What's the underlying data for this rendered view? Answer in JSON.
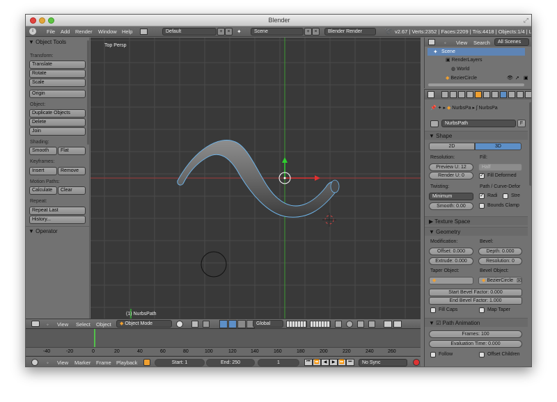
{
  "window": {
    "title": "Blender"
  },
  "topbar": {
    "menus": [
      "File",
      "Add",
      "Render",
      "Window",
      "Help"
    ],
    "layout": "Default",
    "scene": "Scene",
    "engine": "Blender Render",
    "stats": "v2.67 | Verts:2352 | Faces:2209 | Tris:4418 | Objects:1/4 | La"
  },
  "toolshelf": {
    "title": "Object Tools",
    "transform_label": "Transform:",
    "translate": "Translate",
    "rotate": "Rotate",
    "scale": "Scale",
    "origin": "Origin",
    "object_label": "Object:",
    "duplicate": "Duplicate Objects",
    "delete": "Delete",
    "join": "Join",
    "shading_label": "Shading:",
    "smooth": "Smooth",
    "flat": "Flat",
    "keyframes_label": "Keyframes:",
    "insert": "Insert",
    "remove": "Remove",
    "motion_label": "Motion Paths:",
    "calculate": "Calculate",
    "clear": "Clear",
    "repeat_label": "Repeat:",
    "repeat_last": "Repeat Last",
    "history": "History...",
    "operator": "Operator"
  },
  "viewport": {
    "view_name": "Top Persp",
    "object_label": "(1) NurbsPath"
  },
  "view_header": {
    "view": "View",
    "select": "Select",
    "object": "Object",
    "mode": "Object Mode",
    "orientation": "Global"
  },
  "timeline": {
    "ticks": [
      "-40",
      "-20",
      "0",
      "20",
      "40",
      "60",
      "80",
      "100",
      "120",
      "140",
      "160",
      "180",
      "200",
      "220",
      "240",
      "260"
    ],
    "view": "View",
    "marker": "Marker",
    "frame": "Frame",
    "playback": "Playback",
    "start": "Start: 1",
    "end": "End: 250",
    "current": "1",
    "sync": "No Sync"
  },
  "outliner": {
    "view": "View",
    "search": "Search",
    "all_scenes": "All Scenes",
    "items": [
      "Scene",
      "RenderLayers",
      "World",
      "BezierCircle"
    ]
  },
  "properties": {
    "breadcrumb_1": "NurbsPa",
    "breadcrumb_2": "NurbsPa",
    "data_name": "NurbsPath",
    "fake_user": "F",
    "shape": "Shape",
    "btn_2d": "2D",
    "btn_3d": "3D",
    "resolution_label": "Resolution:",
    "fill_label": "Fill:",
    "preview_u": "Preview U: 12",
    "render_u": "Render U: 0",
    "fill_value": "Half",
    "fill_deformed": "Fill Deformed",
    "twisting_label": "Twisting:",
    "path_label": "Path / Curve-Defor",
    "twist_mode": "Minimum",
    "radius": "Radi",
    "stretch": "Stre",
    "smooth": "Smooth: 0.00",
    "bounds_clamp": "Bounds Clamp",
    "texture_space": "Texture Space",
    "geometry": "Geometry",
    "modification_label": "Modification:",
    "bevel_label": "Bevel:",
    "offset": "Offset: 0.000",
    "depth": "Depth: 0.000",
    "extrude": "Extrude: 0.000",
    "resolution": "Resolution: 0",
    "taper_label": "Taper Object:",
    "bevel_obj_label": "Bevel Object:",
    "bevel_obj": "BezierCircle",
    "start_bevel": "Start Bevel Factor: 0.000",
    "end_bevel": "End Bevel Factor: 1.000",
    "fill_caps": "Fill Caps",
    "map_taper": "Map Taper",
    "path_animation": "Path Animation",
    "frames": "Frames: 100",
    "eval_time": "Evaluation Time: 0.000",
    "follow": "Follow",
    "offset_children": "Offset Children"
  }
}
